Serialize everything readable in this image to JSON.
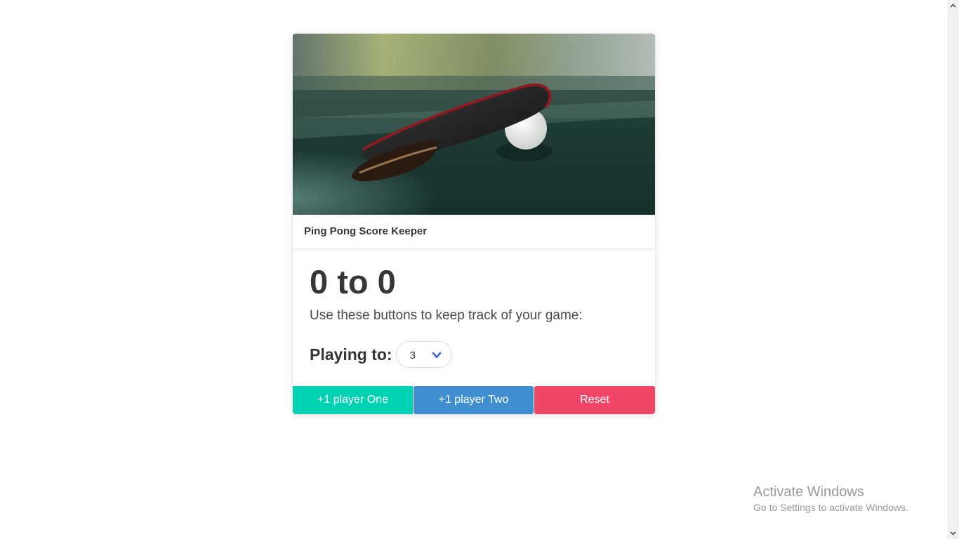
{
  "card": {
    "title": "Ping Pong Score Keeper",
    "image_alt": "table-tennis-paddle-and-ball-photo"
  },
  "score": {
    "player_one": "0",
    "separator": "to",
    "player_two": "0",
    "display": "0 to 0"
  },
  "instruction": "Use these buttons to keep track of your game:",
  "playing_to": {
    "label": "Playing to:",
    "selected_value": "3",
    "icon": "chevron-down-icon"
  },
  "buttons": {
    "player_one": "+1 player One",
    "player_two": "+1 player Two",
    "reset": "Reset"
  },
  "colors": {
    "player_one_button": "#00d1b2",
    "player_two_button": "#3e8ed0",
    "reset_button": "#f14668",
    "chevron": "#485fc7"
  },
  "watermark": {
    "title": "Activate Windows",
    "subtitle": "Go to Settings to activate Windows."
  }
}
